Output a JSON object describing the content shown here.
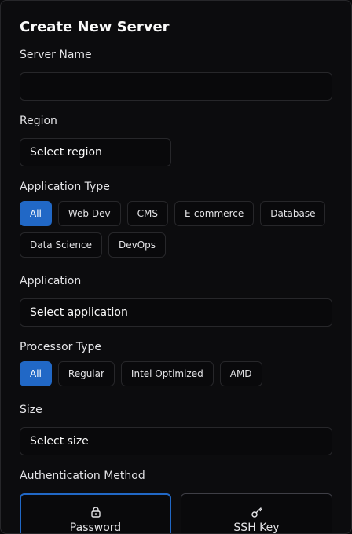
{
  "title": "Create New Server",
  "server_name": {
    "label": "Server Name",
    "value": "",
    "placeholder": ""
  },
  "region": {
    "label": "Region",
    "selected": "Select region"
  },
  "application_type": {
    "label": "Application Type",
    "options": [
      "All",
      "Web Dev",
      "CMS",
      "E-commerce",
      "Database",
      "Data Science",
      "DevOps"
    ],
    "active": "All"
  },
  "application": {
    "label": "Application",
    "selected": "Select application"
  },
  "processor_type": {
    "label": "Processor Type",
    "options": [
      "All",
      "Regular",
      "Intel Optimized",
      "AMD"
    ],
    "active": "All"
  },
  "size": {
    "label": "Size",
    "selected": "Select size"
  },
  "auth": {
    "label": "Authentication Method",
    "options": [
      {
        "label": "Password",
        "icon": "lock-icon"
      },
      {
        "label": "SSH Key",
        "icon": "key-icon"
      }
    ],
    "selected": "Password"
  },
  "colors": {
    "accent": "#2168c6",
    "border": "#27272a",
    "background": "#0c0c0e"
  }
}
